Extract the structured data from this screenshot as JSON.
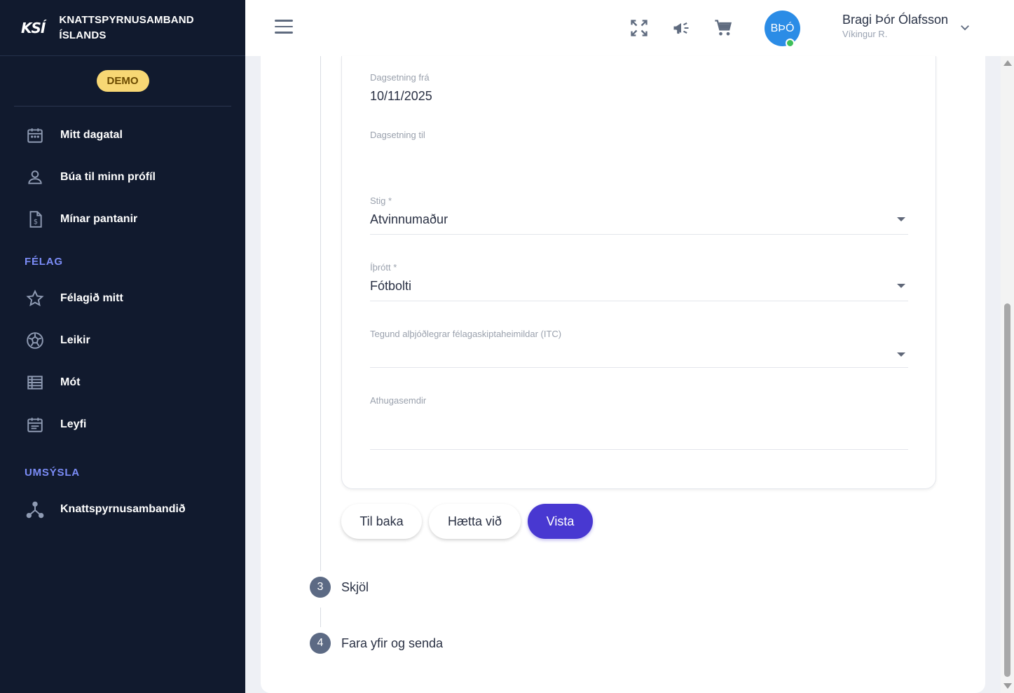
{
  "brand": {
    "logo_text": "KSÍ",
    "name_line1": "KNATTSPYRNUSAMBAND",
    "name_line2": "ÍSLANDS",
    "demo_badge": "DEMO"
  },
  "sidebar": {
    "items": [
      {
        "label": "Mitt dagatal",
        "icon": "calendar-icon"
      },
      {
        "label": "Búa til minn prófíl",
        "icon": "person-icon"
      },
      {
        "label": "Mínar pantanir",
        "icon": "invoice-icon"
      }
    ],
    "sections": [
      {
        "title": "FÉLAG",
        "items": [
          {
            "label": "Félagið mitt",
            "icon": "star-icon"
          },
          {
            "label": "Leikir",
            "icon": "soccer-ball-icon"
          },
          {
            "label": "Mót",
            "icon": "list-icon"
          },
          {
            "label": "Leyfi",
            "icon": "license-icon"
          }
        ]
      },
      {
        "title": "UMSÝSLA",
        "items": [
          {
            "label": "Knattspyrnusambandið",
            "icon": "hub-icon"
          }
        ]
      }
    ]
  },
  "topbar": {
    "icons": [
      "menu-icon",
      "fullscreen-icon",
      "megaphone-icon",
      "cart-icon"
    ],
    "user": {
      "initials": "BÞÓ",
      "name": "Bragi Þór Ólafsson",
      "club": "Víkingur R."
    }
  },
  "form": {
    "date_from": {
      "label": "Dagsetning frá",
      "value": "10/11/2025"
    },
    "date_to": {
      "label": "Dagsetning til",
      "value": ""
    },
    "level": {
      "label": "Stig *",
      "value": "Atvinnumaður"
    },
    "sport": {
      "label": "Íþrótt *",
      "value": "Fótbolti"
    },
    "itc_type": {
      "label": "Tegund alþjóðlegrar félagaskiptaheimildar (ITC)",
      "value": ""
    },
    "notes": {
      "label": "Athugasemdir",
      "value": ""
    }
  },
  "actions": {
    "back": "Til baka",
    "cancel": "Hætta við",
    "save": "Vista"
  },
  "steps": [
    {
      "number": "3",
      "label": "Skjöl"
    },
    {
      "number": "4",
      "label": "Fara yfir og senda"
    }
  ],
  "colors": {
    "sidebar_bg": "#111a2e",
    "section_label": "#7b8cf7",
    "demo_badge": "#f7d774",
    "primary": "#4838d1",
    "avatar": "#2b8ce6",
    "online": "#3fbf5a"
  }
}
